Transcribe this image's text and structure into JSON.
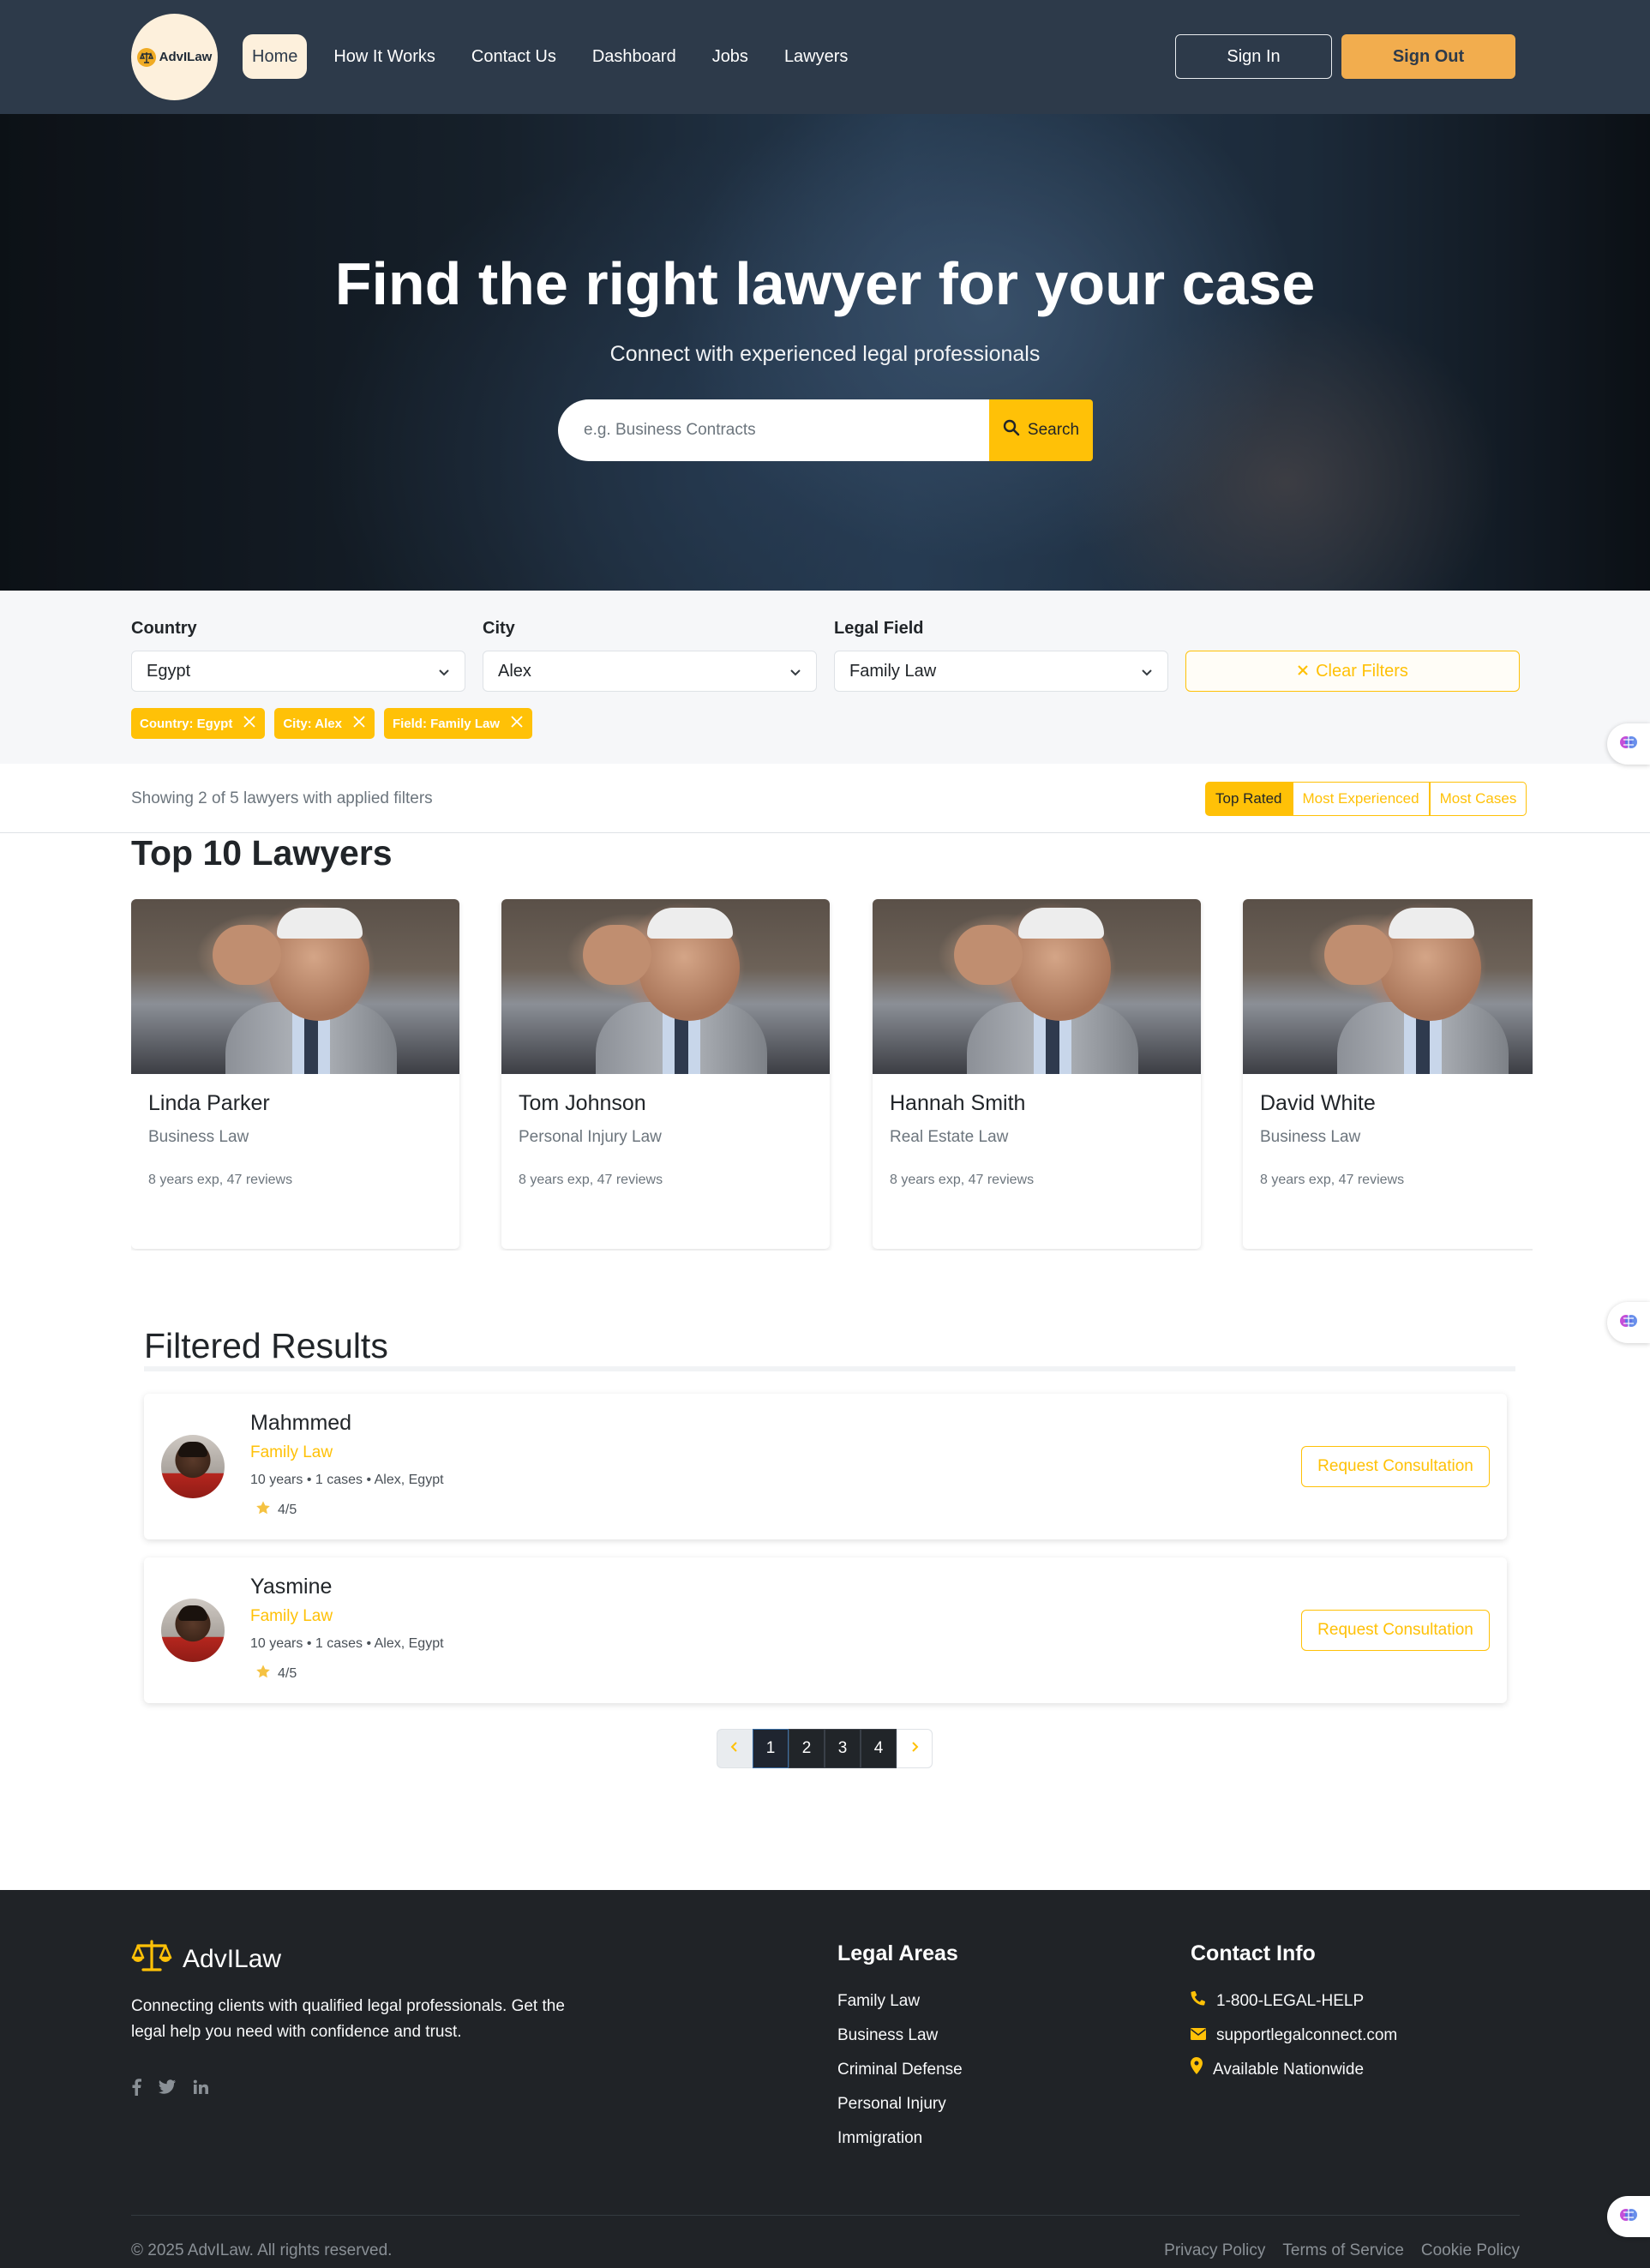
{
  "nav": {
    "logo_text": "AdvILaw",
    "links": [
      "Home",
      "How It Works",
      "Contact Us",
      "Dashboard",
      "Jobs",
      "Lawyers"
    ],
    "sign_in": "Sign In",
    "sign_out": "Sign Out"
  },
  "hero": {
    "title": "Find the right lawyer for your case",
    "subtitle": "Connect with experienced legal professionals",
    "search_placeholder": "e.g. Business Contracts",
    "search_button": "Search"
  },
  "filters": {
    "country_label": "Country",
    "country_value": "Egypt",
    "city_label": "City",
    "city_value": "Alex",
    "field_label": "Legal Field",
    "field_value": "Family Law",
    "clear_button": "Clear Filters",
    "tags": [
      "Country: Egypt",
      "City: Alex",
      "Field: Family Law"
    ]
  },
  "results": {
    "count_text": "Showing 2 of 5 lawyers with applied filters",
    "sort_options": [
      "Top Rated",
      "Most Experienced",
      "Most Cases"
    ],
    "active_sort": "Top Rated"
  },
  "top_lawyers": {
    "title": "Top 10 Lawyers",
    "cards": [
      {
        "name": "Linda Parker",
        "field": "Business Law",
        "meta": "8 years exp, 47 reviews"
      },
      {
        "name": "Tom Johnson",
        "field": "Personal Injury Law",
        "meta": "8 years exp, 47 reviews"
      },
      {
        "name": "Hannah Smith",
        "field": "Real Estate Law",
        "meta": "8 years exp, 47 reviews"
      },
      {
        "name": "David White",
        "field": "Business Law",
        "meta": "8 years exp, 47 reviews"
      }
    ]
  },
  "filtered": {
    "title": "Filtered Results",
    "items": [
      {
        "name": "Mahmmed",
        "field": "Family Law",
        "meta": "10 years • 1 cases • Alex, Egypt",
        "rating": "4/5",
        "button": "Request Consultation"
      },
      {
        "name": "Yasmine",
        "field": "Family Law",
        "meta": "10 years • 1 cases • Alex, Egypt",
        "rating": "4/5",
        "button": "Request Consultation"
      }
    ]
  },
  "pagination": {
    "pages": [
      "1",
      "2",
      "3",
      "4"
    ],
    "current": "1"
  },
  "footer": {
    "brand": "AdvILaw",
    "description": "Connecting clients with qualified legal professionals. Get the legal help you need with confidence and trust.",
    "legal_title": "Legal Areas",
    "legal_items": [
      "Family Law",
      "Business Law",
      "Criminal Defense",
      "Personal Injury",
      "Immigration"
    ],
    "contact_title": "Contact Info",
    "contact_items": [
      "1-800-LEGAL-HELP",
      "supportlegalconnect.com",
      "Available Nationwide"
    ],
    "copyright": "© 2025 AdvILaw. All rights reserved.",
    "bottom_links": [
      "Privacy Policy",
      "Terms of Service",
      "Cookie Policy"
    ]
  },
  "colors": {
    "navbar": "#2d3a4a",
    "accent": "#ffc107",
    "signout": "#f2ad4e",
    "footer": "#202327"
  }
}
